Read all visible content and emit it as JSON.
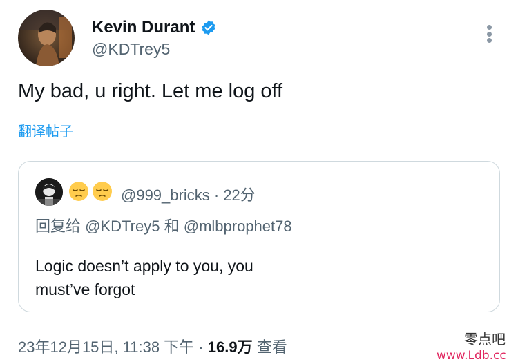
{
  "tweet": {
    "author_name": "Kevin Durant",
    "author_handle": "@KDTrey5",
    "text": "My bad, u right. Let me log off",
    "translate_label": "翻译帖子",
    "timestamp": "23年12月15日, 11:38 下午",
    "separator": "·",
    "views_count": "16.9万",
    "views_label": "查看"
  },
  "quoted": {
    "handle": "@999_bricks",
    "separator": "·",
    "time": "22分",
    "reply_prefix": "回复给",
    "reply_to_1": "@KDTrey5",
    "reply_conj": "和",
    "reply_to_2": "@mlbprophet78",
    "text_line1": "Logic doesn’t apply to you, you",
    "text_line2": "must’ve forgot"
  },
  "watermark": {
    "line1": "零点吧",
    "line2": "www.Ldb.cc"
  },
  "icons": {
    "verified": "verified-badge-icon",
    "more": "more-vertical-icon",
    "emoji": "pensive-face-emoji"
  },
  "colors": {
    "accent": "#1d9bf0",
    "secondary_text": "#536471",
    "primary_text": "#0f1419",
    "border": "#cfd9de",
    "watermark": "#e0245e"
  }
}
